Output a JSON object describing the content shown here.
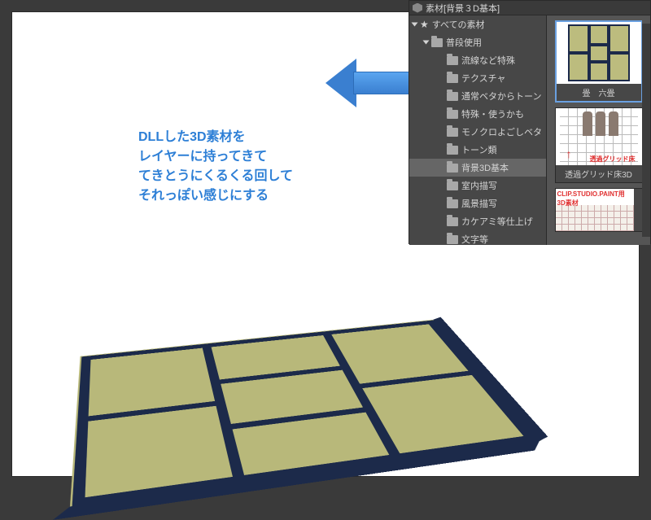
{
  "panel": {
    "title": "素材[背景３D基本]",
    "tree": {
      "root": "すべての素材",
      "group": "普段使用",
      "items": [
        "流線など特殊",
        "テクスチャ",
        "通常ベタからトーン",
        "特殊・使うかも",
        "モノクロよごしベタ",
        "トーン類",
        "背景3D基本",
        "室内描写",
        "風景描写",
        "カケアミ等仕上げ",
        "文字等"
      ],
      "selected_index": 6
    },
    "thumbs": [
      {
        "label": "畳　六畳"
      },
      {
        "label": "透過グリッド床3D",
        "overlay": "透過グリッド床"
      },
      {
        "label_top": "CLIP.STUDIO.PAINT用",
        "label_top2": "3D素材"
      }
    ]
  },
  "instruction": "DLLした3D素材を\nレイヤーに持ってきて\nてきとうにくるくる回して\nそれっぽい感じにする"
}
